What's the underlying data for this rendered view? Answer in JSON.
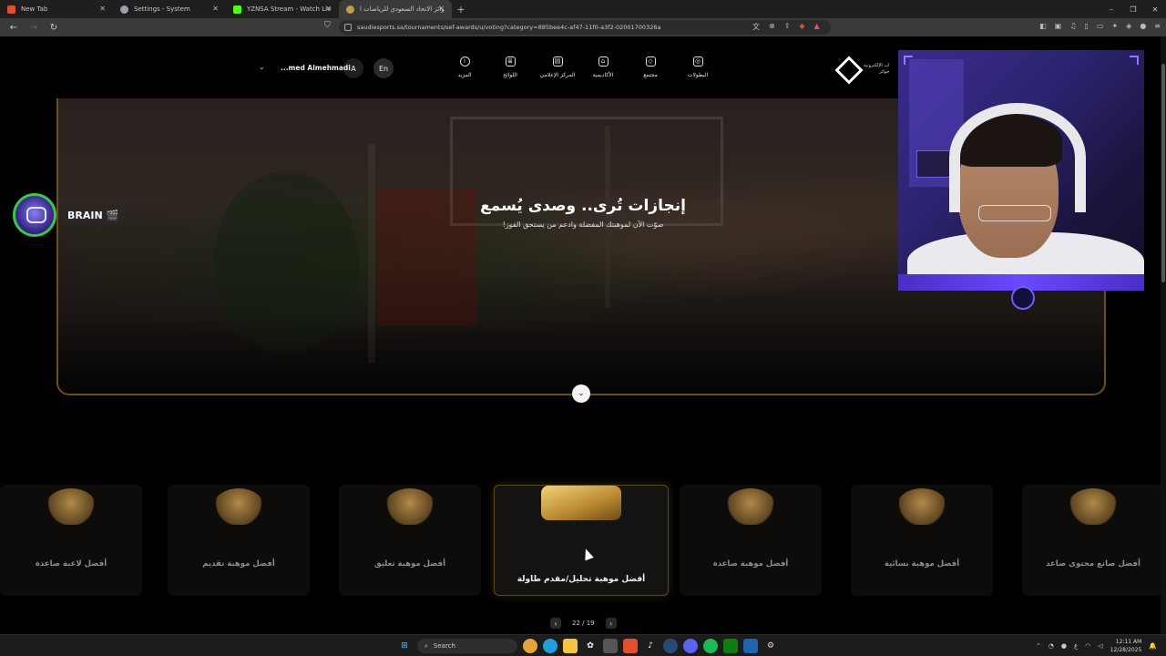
{
  "browser": {
    "tabs": [
      {
        "title": "New Tab",
        "favicon_color": "#e24f2f"
      },
      {
        "title": "Settings - System",
        "favicon_color": "#9aa0a6"
      },
      {
        "title": "YZNSA Stream - Watch Live on Kick",
        "favicon_color": "#53fc18"
      },
      {
        "title": "جوائز الاتحاد السعودي للرياضات ا...",
        "favicon_color": "#c69a4c",
        "active": true
      }
    ],
    "new_tab_symbol": "+",
    "close_symbol": "✕",
    "window_controls": {
      "minimize": "–",
      "restore": "❐",
      "close": "✕"
    },
    "url": "saudiesports.sa/tournaments/sef-awards/u/voting?category=885bee4c-af47-11f0-a3f2-02001700326a"
  },
  "site_nav": {
    "items": [
      {
        "label": "البطولات",
        "icon": "gamepad-icon"
      },
      {
        "label": "مجتمع",
        "icon": "community-icon"
      },
      {
        "label": "الأكاديمية",
        "icon": "academy-icon"
      },
      {
        "label": "المركز الإعلامي",
        "icon": "media-icon"
      },
      {
        "label": "اللوائح",
        "icon": "rules-icon"
      },
      {
        "label": "المزيد",
        "icon": "more-icon"
      }
    ],
    "lang_button": "En",
    "avatar_letter": "A",
    "username": "...med Almehmadi",
    "logo_text_1": "ات الإلكترونية",
    "logo_text_2": "جوائز"
  },
  "hero": {
    "title": "إنجازات تُرى.. وصدى يُسمع",
    "subtitle": "صوّت الآن لموهبتك المفضلة وادعم من يستحق الفوز!",
    "scroll_icon": "⌄"
  },
  "stream_overlay": {
    "name": "BRAIN",
    "badge": "🎬"
  },
  "categories": [
    {
      "label": "أفضل لاعبة صاعدة",
      "active": false
    },
    {
      "label": "أفضل موهبة تقديم",
      "active": false
    },
    {
      "label": "أفضل موهبة تعليق",
      "active": false
    },
    {
      "label": "أفضل موهبة تحليل/مقدم طاولة",
      "active": true
    },
    {
      "label": "أفضل موهبة صاعدة",
      "active": false
    },
    {
      "label": "أفضل موهبة نسائية",
      "active": false
    },
    {
      "label": "أفضل صانع محتوى صاعد",
      "active": false
    }
  ],
  "pager": {
    "text": "22 / 19",
    "prev": "‹",
    "next": "›"
  },
  "taskbar": {
    "search_label": "Search",
    "time": "12:11 AM",
    "date": "12/28/2025",
    "lang_indicator": "ع"
  }
}
